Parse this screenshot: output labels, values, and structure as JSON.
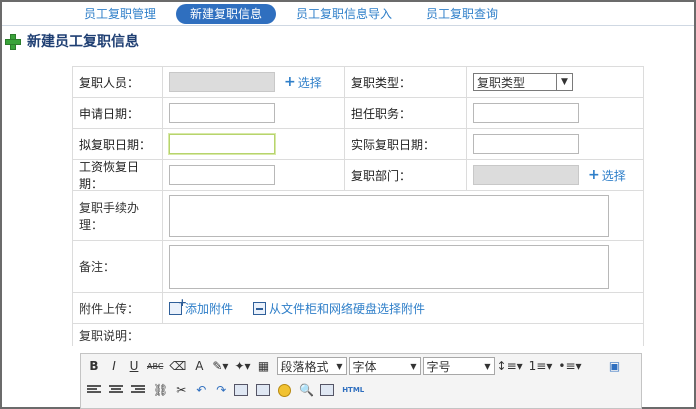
{
  "tabs": [
    {
      "label": "员工复职管理"
    },
    {
      "label": "新建复职信息",
      "active": true
    },
    {
      "label": "员工复职信息导入"
    },
    {
      "label": "员工复职查询"
    }
  ],
  "page_title": "新建员工复职信息",
  "form": {
    "employee_label": "复职人员：",
    "select_link": "选择",
    "type_label": "复职类型：",
    "type_value": "复职类型",
    "apply_date_label": "申请日期：",
    "position_label": "担任职务：",
    "planned_date_label": "拟复职日期：",
    "actual_date_label": "实际复职日期：",
    "salary_date_label": "工资恢复日期：",
    "dept_label": "复职部门：",
    "dept_select_link": "选择",
    "procedure_label": "复职手续办理：",
    "remark_label": "备注：",
    "attach_label": "附件上传：",
    "add_attach": "添加附件",
    "cabinet_attach": "从文件柜和网络硬盘选择附件",
    "desc_label": "复职说明："
  },
  "editor": {
    "bold": "B",
    "italic": "I",
    "underline": "U",
    "strike": "ABC",
    "font_color": "A",
    "paragraph_format": "段落格式",
    "font_family": "字体",
    "font_size": "字号",
    "html": "HTML"
  }
}
